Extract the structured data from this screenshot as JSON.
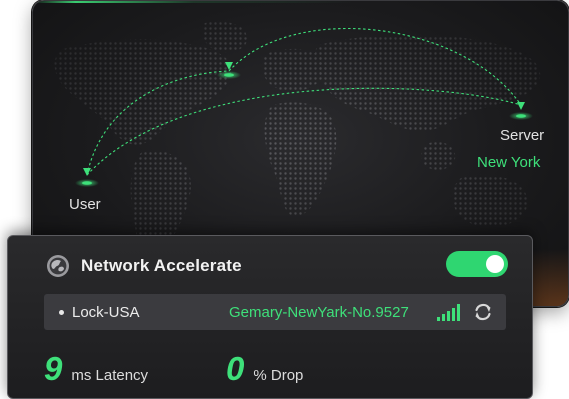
{
  "map": {
    "user_label": "User",
    "server_label": "Server",
    "server_location": "New York",
    "accent_color": "#3ee07a"
  },
  "panel": {
    "icon": "globe-icon",
    "title": "Network Accelerate",
    "toggle_on": true,
    "route": {
      "name": "Lock-USA",
      "server": "Gemary-NewYark-No.9527",
      "signal_icon": "signal-bars-icon",
      "refresh_icon": "refresh-icon"
    },
    "stats": {
      "latency_value": "9",
      "latency_label": "ms Latency",
      "drop_value": "0",
      "drop_label": "% Drop"
    }
  }
}
